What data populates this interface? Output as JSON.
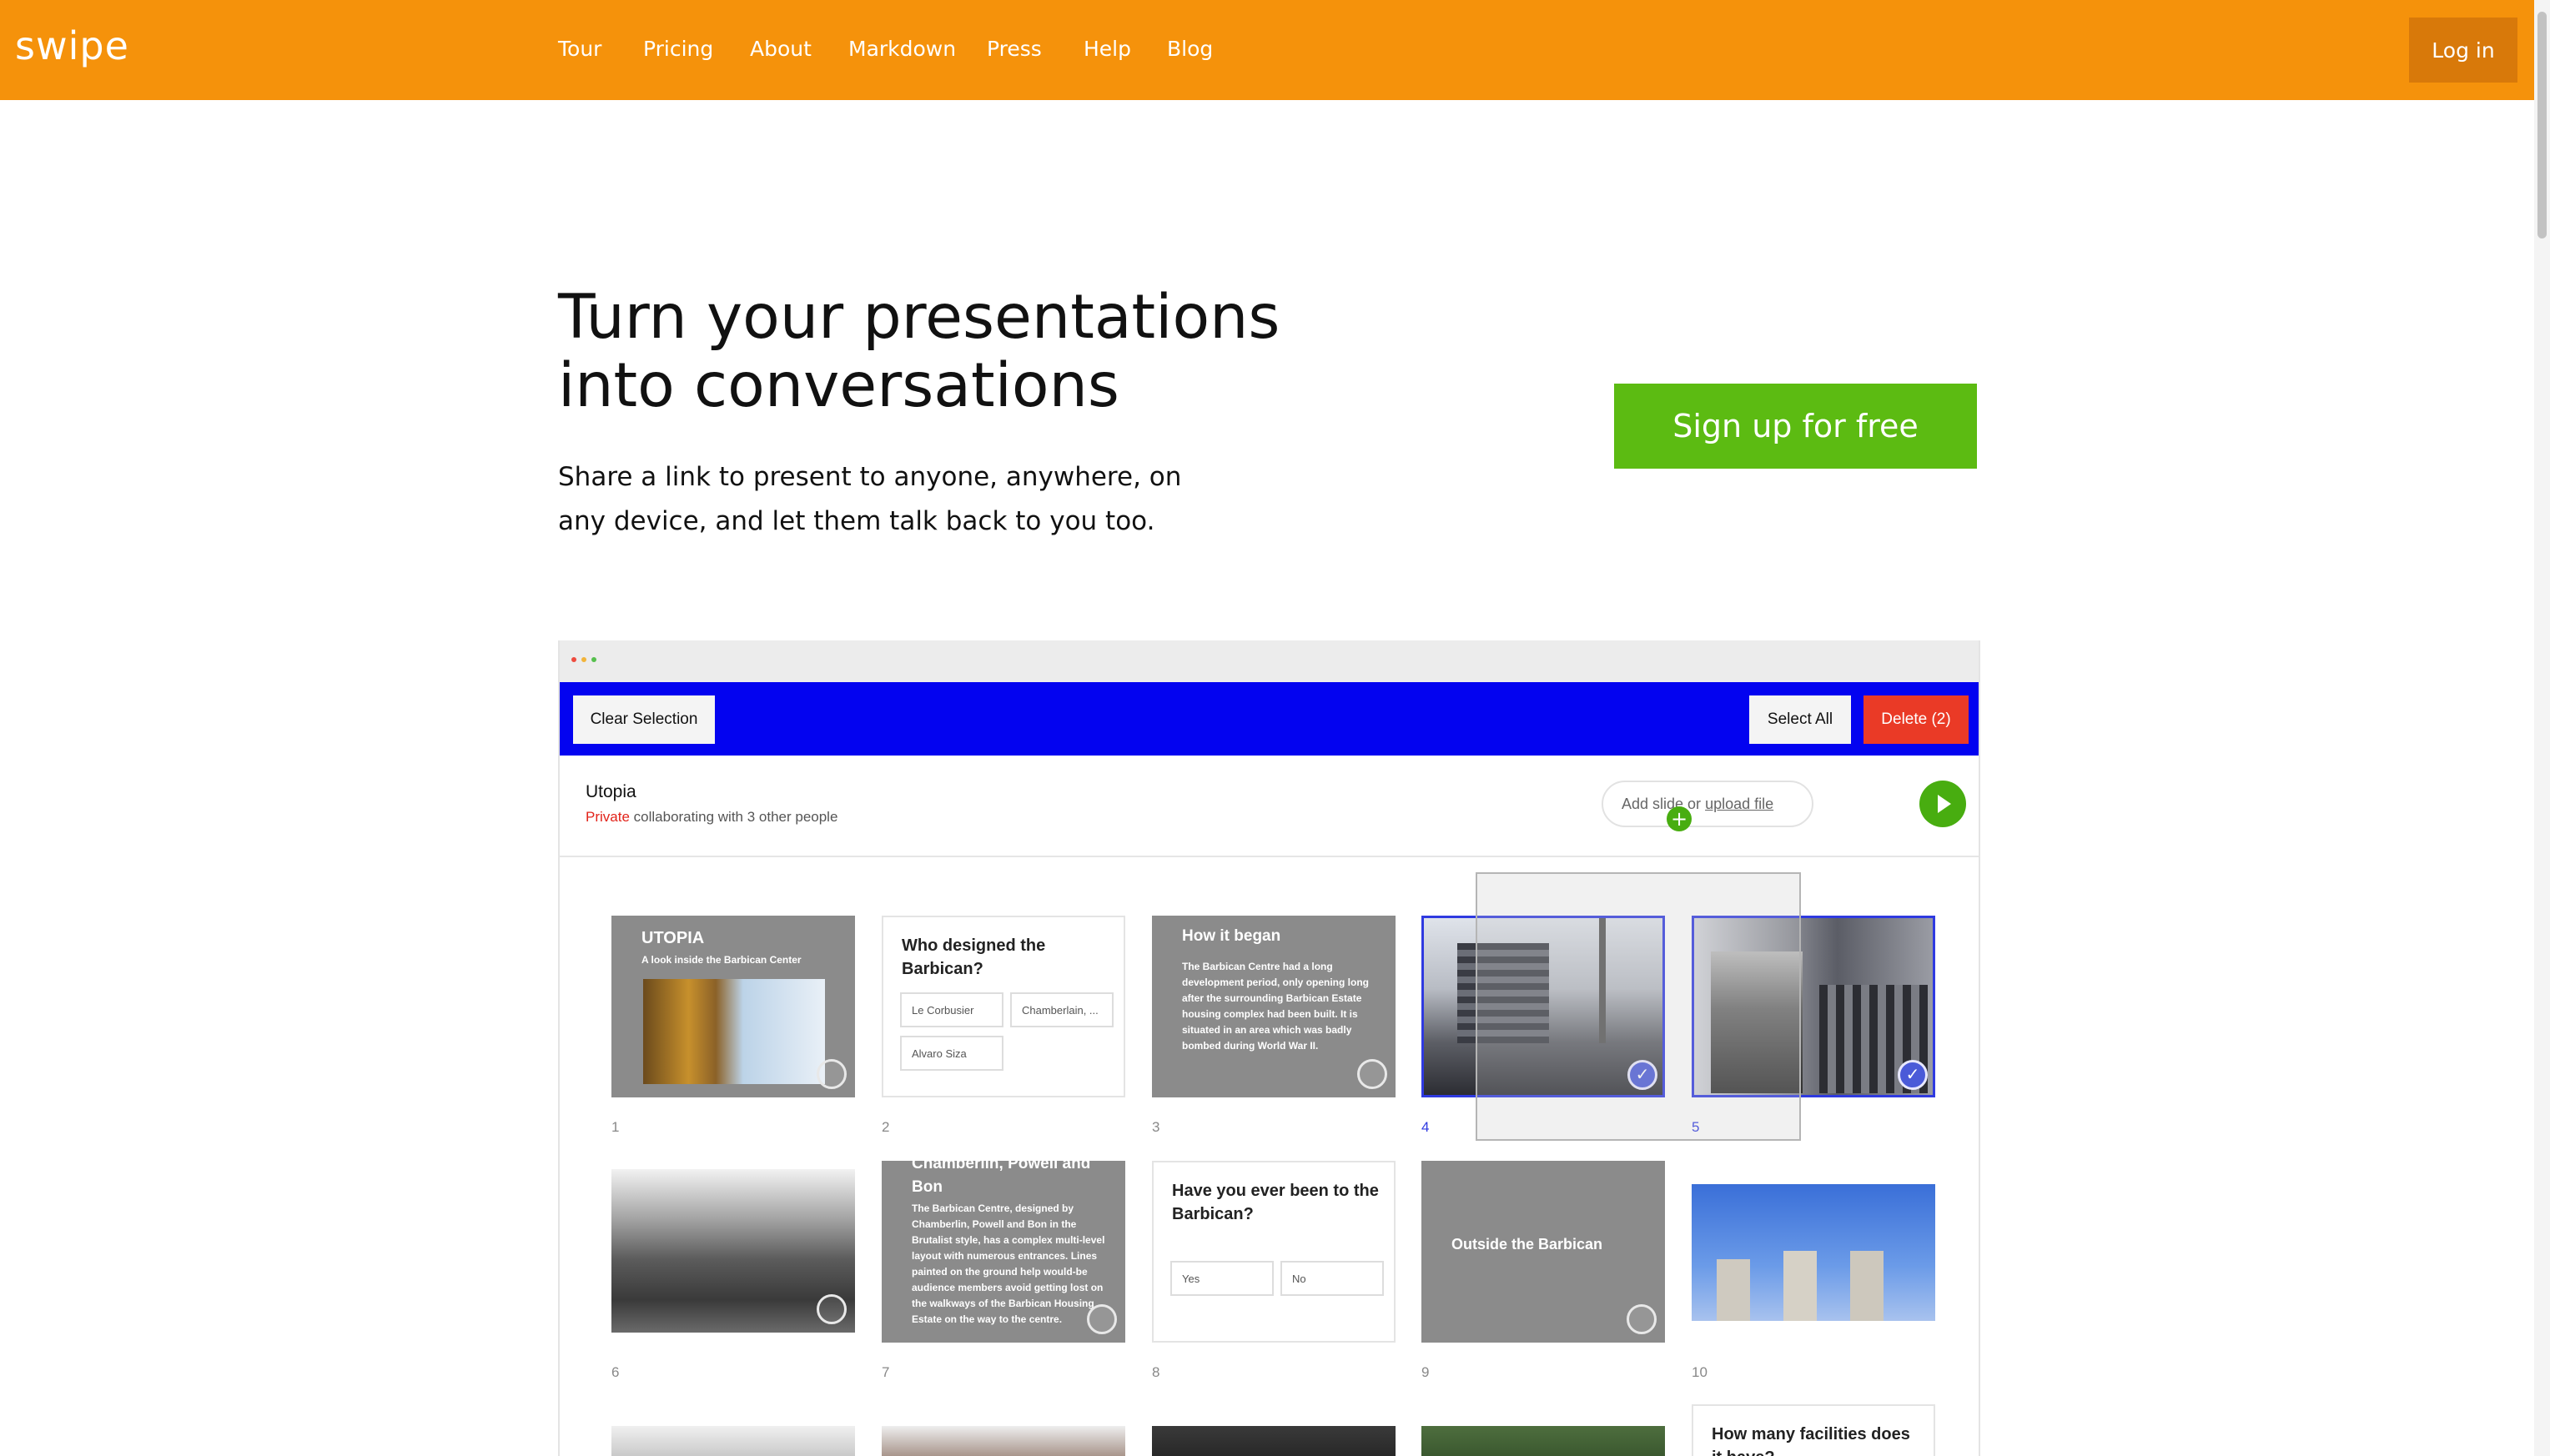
{
  "nav": {
    "logo": "swipe",
    "items": [
      "Tour",
      "Pricing",
      "About",
      "Markdown",
      "Press",
      "Help",
      "Blog"
    ],
    "login": "Log in"
  },
  "hero": {
    "title_line1": "Turn your presentations",
    "title_line2": "into conversations",
    "sub_line1": "Share a link to present to anyone, anywhere, on",
    "sub_line2": "any device, and let them talk back to you too.",
    "signup": "Sign up for free"
  },
  "app": {
    "clear_selection": "Clear Selection",
    "select_all": "Select All",
    "delete": "Delete (2)",
    "doc_title": "Utopia",
    "doc_private": "Private",
    "doc_collab": " collaborating with 3 other people",
    "add_slide": "Add slide or ",
    "upload_file": "upload file",
    "add_icon": "plus-icon",
    "play_icon": "play-icon",
    "slides": {
      "s1": {
        "num": "1",
        "title": "UTOPIA",
        "sub": "A look inside the Barbican Center"
      },
      "s2": {
        "num": "2",
        "question": "Who designed the Barbican?",
        "opt1": "Le Corbusier",
        "opt2": "Chamberlain, ...",
        "opt3": "Alvaro Siza"
      },
      "s3": {
        "num": "3",
        "head": "How it began",
        "body": "The Barbican Centre had a long development period, only opening long after the surrounding Barbican Estate housing complex had been built. It is situated in an area which was badly bombed during World War II."
      },
      "s4": {
        "num": "4"
      },
      "s5": {
        "num": "5"
      },
      "s6": {
        "num": "6"
      },
      "s7": {
        "num": "7",
        "head": "Chamberlin, Powell and Bon",
        "body": "The Barbican Centre, designed by Chamberlin, Powell and Bon in the Brutalist style, has a complex multi-level layout with numerous entrances. Lines painted on the ground help would-be audience members avoid getting lost on the walkways of the Barbican Housing Estate on the way to the centre."
      },
      "s8": {
        "num": "8",
        "question": "Have you ever been to the Barbican?",
        "opt1": "Yes",
        "opt2": "No"
      },
      "s9": {
        "num": "9",
        "title": "Outside the Barbican"
      },
      "s10": {
        "num": "10"
      },
      "s15": {
        "question": "How many facilities does it have?"
      }
    }
  },
  "colors": {
    "nav_bg": "#f5920b",
    "signup_bg": "#5cbb12",
    "selection_bar": "#0303f0",
    "delete_bg": "#ea3a26",
    "selected_border": "#2f3ae0"
  }
}
